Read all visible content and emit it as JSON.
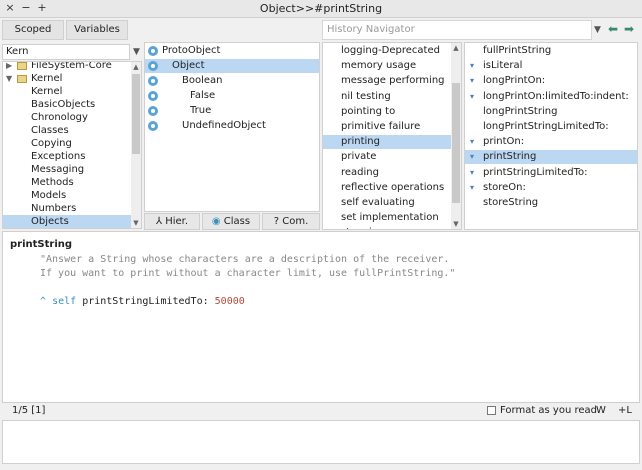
{
  "window": {
    "title": "Object>>#printString",
    "close_glyph": "×",
    "min_glyph": "−",
    "max_glyph": "+"
  },
  "toolbar": {
    "scoped_label": "Scoped",
    "variables_label": "Variables",
    "history_placeholder": "History Navigator",
    "dropdown_glyph": "▼",
    "back_glyph": "⬅",
    "forward_glyph": "➡"
  },
  "packages": {
    "filter_value": "Kern",
    "dropdown_glyph": "▼",
    "items": [
      {
        "label": "FileSystem-Core",
        "kind": "folder"
      },
      {
        "label": "Kernel",
        "kind": "folder-open"
      },
      {
        "label": "Kernel",
        "kind": "tag"
      },
      {
        "label": "BasicObjects",
        "kind": "tag"
      },
      {
        "label": "Chronology",
        "kind": "tag"
      },
      {
        "label": "Classes",
        "kind": "tag"
      },
      {
        "label": "Copying",
        "kind": "tag"
      },
      {
        "label": "Exceptions",
        "kind": "tag"
      },
      {
        "label": "Messaging",
        "kind": "tag"
      },
      {
        "label": "Methods",
        "kind": "tag"
      },
      {
        "label": "Models",
        "kind": "tag"
      },
      {
        "label": "Numbers",
        "kind": "tag"
      },
      {
        "label": "Objects",
        "kind": "tag",
        "selected": true
      }
    ]
  },
  "classes": {
    "items": [
      {
        "label": "ProtoObject",
        "icon": true
      },
      {
        "label": "Object",
        "icon": true,
        "selected": true
      },
      {
        "label": "Boolean",
        "icon": true
      },
      {
        "label": "False",
        "icon": true
      },
      {
        "label": "True",
        "icon": true
      },
      {
        "label": "UndefinedObject",
        "icon": true
      }
    ],
    "mode_buttons": {
      "hier_label": "Hier.",
      "class_label": "Class",
      "com_label": "Com."
    }
  },
  "protocols": {
    "items": [
      {
        "label": "logging-Deprecated"
      },
      {
        "label": "memory usage"
      },
      {
        "label": "message performing"
      },
      {
        "label": "nil testing"
      },
      {
        "label": "pointing to"
      },
      {
        "label": "primitive failure"
      },
      {
        "label": "printing",
        "selected": true
      },
      {
        "label": "private"
      },
      {
        "label": "reading"
      },
      {
        "label": "reflective operations"
      },
      {
        "label": "self evaluating"
      },
      {
        "label": "set implementation"
      },
      {
        "label": "stepping"
      }
    ]
  },
  "methods": {
    "items": [
      {
        "label": "fullPrintString",
        "override": false
      },
      {
        "label": "isLiteral",
        "override": true
      },
      {
        "label": "longPrintOn:",
        "override": true
      },
      {
        "label": "longPrintOn:limitedTo:indent:",
        "override": true
      },
      {
        "label": "longPrintString",
        "override": false
      },
      {
        "label": "longPrintStringLimitedTo:",
        "override": false
      },
      {
        "label": "printOn:",
        "override": true
      },
      {
        "label": "printString",
        "override": true,
        "selected": true
      },
      {
        "label": "printStringLimitedTo:",
        "override": true
      },
      {
        "label": "storeOn:",
        "override": true
      },
      {
        "label": "storeString",
        "override": false
      }
    ]
  },
  "editor": {
    "selector": "printString",
    "comment_line1": "\"Answer a String whose characters are a description of the receiver.",
    "comment_line2": "If you want to print without a character limit, use fullPrintString.\"",
    "caret": "^",
    "self_kw": "self",
    "message": "printStringLimitedTo:",
    "argument": "50000"
  },
  "status": {
    "position": "1/5 [1]",
    "format_label": "Format as you read",
    "w_label": "W",
    "l_label": "+L"
  },
  "icons": {
    "override": "▾",
    "expand": "▶",
    "expanded": "▼"
  }
}
